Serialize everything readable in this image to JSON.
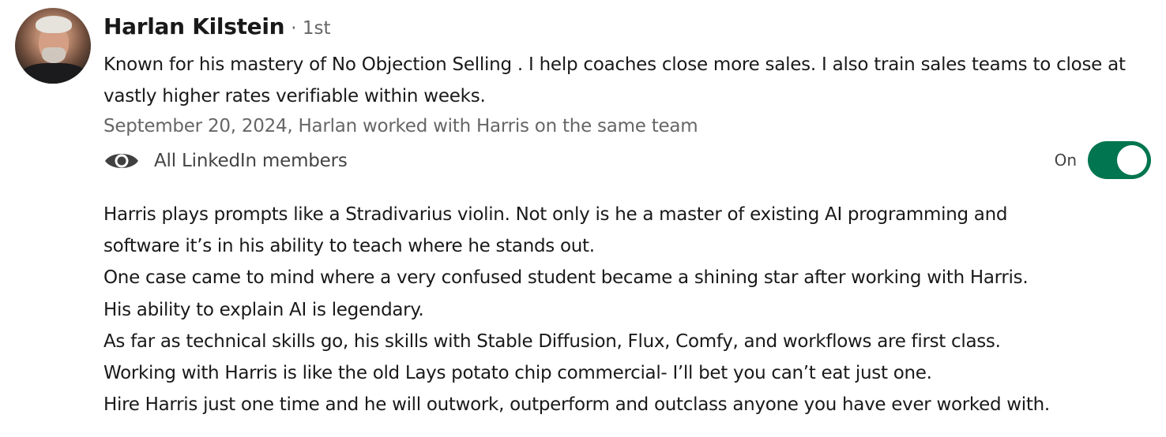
{
  "profile": {
    "name": "Harlan Kilstein",
    "degree": "· 1st",
    "headline": "Known for his mastery of No Objection Selling . I help coaches close more sales. I also train sales teams to close at vastly higher rates verifiable within weeks.",
    "meta": "September 20, 2024, Harlan worked with Harris on the same team"
  },
  "visibility": {
    "icon": "eye-icon",
    "label": "All LinkedIn members",
    "toggle_label": "On",
    "toggle_state": true,
    "toggle_color": "#01754f"
  },
  "recommendation": {
    "lines": [
      "Harris plays prompts like a Stradivarius violin. Not only is he a master of existing AI programming and",
      "software it’s in his ability to teach where he stands out.",
      "One case came to mind where a very confused student became a shining star after working with Harris.",
      "His ability to explain AI is legendary.",
      "As far as technical skills go, his skills with Stable Diffusion, Flux, Comfy, and workflows are first class.",
      "Working with Harris is like the old Lays potato chip commercial- I’ll bet you can’t eat just one.",
      "Hire Harris just one time and he will outwork, outperform and outclass anyone you have ever worked with."
    ]
  }
}
